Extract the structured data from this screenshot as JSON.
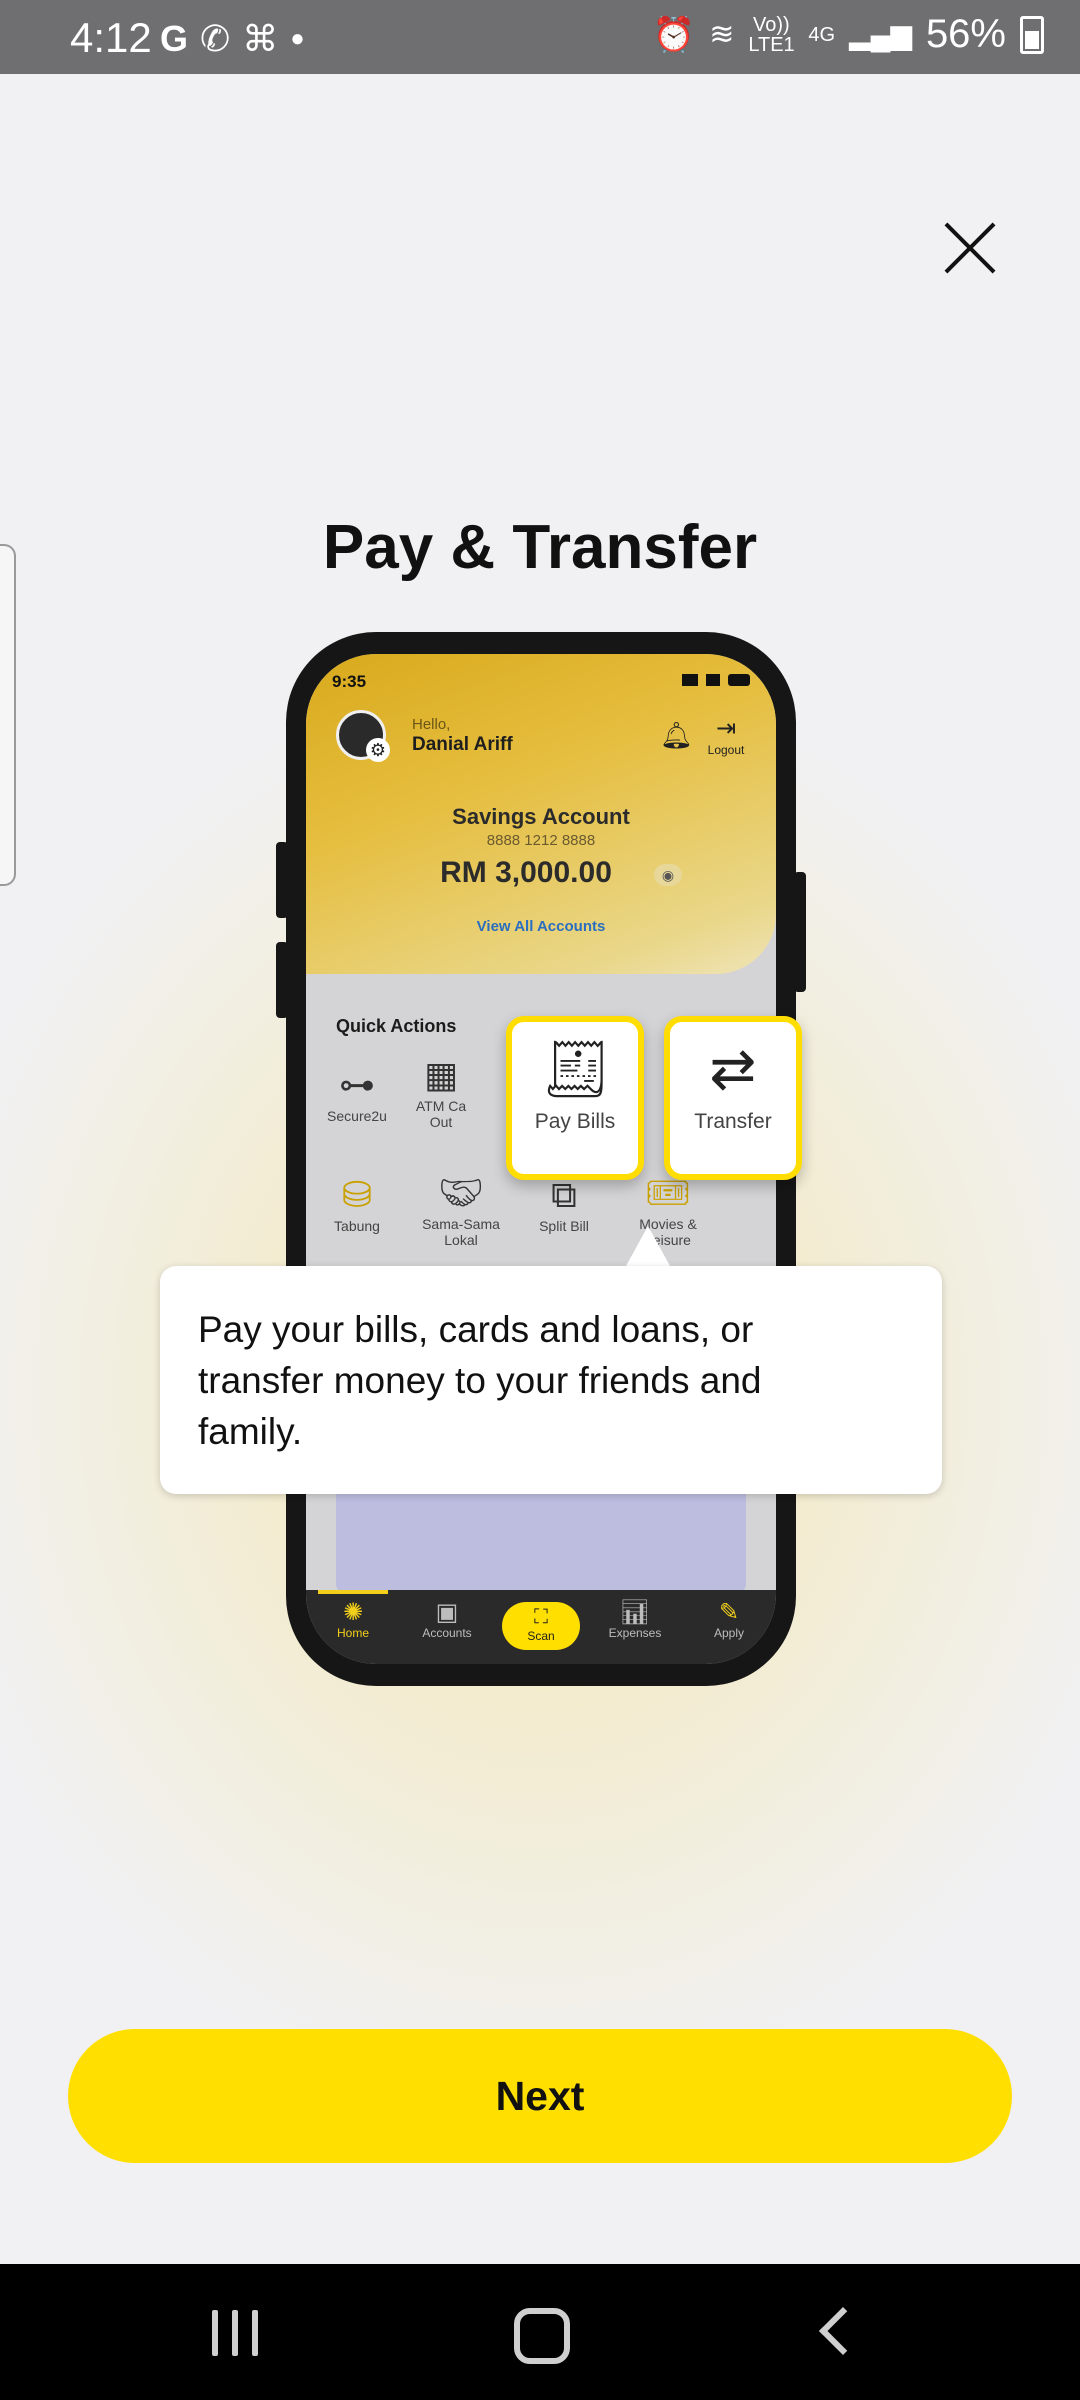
{
  "status_bar": {
    "time": "4:12",
    "left_icons": [
      "google-icon",
      "whatsapp-icon",
      "app-icon",
      "dot-icon"
    ],
    "volte_label": "Vo)) LTE1",
    "network_label": "4G",
    "battery_percent": "56%"
  },
  "onboarding": {
    "title": "Pay & Transfer",
    "tooltip": "Pay your bills, cards and loans, or transfer money to your friends and family.",
    "next_label": "Next"
  },
  "phone": {
    "time": "9:35",
    "greeting": "Hello,",
    "user_name": "Danial Ariff",
    "logout_label": "Logout",
    "account_title": "Savings Account",
    "account_number": "8888 1212 8888",
    "balance": "RM 3,000.00",
    "view_all": "View All Accounts",
    "quick_actions_title": "Quick Actions",
    "quick_actions": [
      {
        "label": "Secure2u",
        "icon": "key-icon"
      },
      {
        "label": "ATM Ca Out",
        "icon": "atm-icon"
      },
      {
        "label": "Tabung",
        "icon": "jar-icon"
      },
      {
        "label": "Sama-Sama Lokal",
        "icon": "handshake-icon"
      },
      {
        "label": "Split Bill",
        "icon": "split-bill-icon"
      },
      {
        "label": "Movies & Leisure",
        "icon": "ticket-icon"
      }
    ],
    "highlighted": [
      {
        "label": "Pay Bills",
        "icon": "bill-icon"
      },
      {
        "label": "Transfer",
        "icon": "transfer-icon"
      }
    ],
    "tabs": [
      "Home",
      "Accounts",
      "Scan",
      "Expenses",
      "Apply"
    ]
  },
  "colors": {
    "accent": "#FFDF00",
    "brand_gold": "#D8A91C",
    "link": "#2A6EC0"
  }
}
